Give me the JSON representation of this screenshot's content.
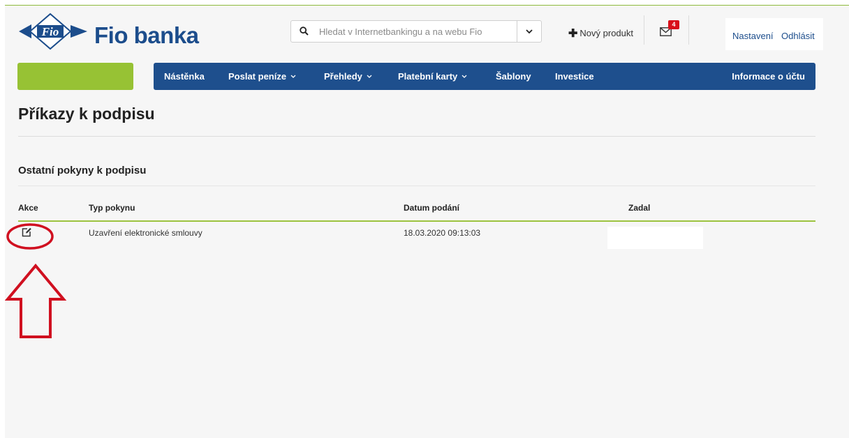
{
  "brand": {
    "name": "Fio banka",
    "logo_mark": "Fio"
  },
  "search": {
    "placeholder": "Hledat v Internetbankingu a na webu Fio"
  },
  "header": {
    "new_product_label": "Nový produkt",
    "messages_count": "4",
    "settings_label": "Nastavení",
    "logout_label": "Odhlásit"
  },
  "nav": {
    "items": [
      {
        "label": "Nástěnka"
      },
      {
        "label": "Poslat peníze"
      },
      {
        "label": "Přehledy"
      },
      {
        "label": "Platební karty"
      },
      {
        "label": "Šablony"
      },
      {
        "label": "Investice"
      },
      {
        "label": "Informace o účtu"
      }
    ]
  },
  "page": {
    "title": "Příkazy k podpisu",
    "section_title": "Ostatní pokyny k podpisu"
  },
  "table": {
    "columns": [
      "Akce",
      "Typ pokynu",
      "Datum podání",
      "Zadal"
    ],
    "rows": [
      {
        "type": "Uzavření elektronické smlouvy",
        "date": "18.03.2020 09:13:03",
        "submitted_by": ""
      }
    ]
  },
  "icons": {
    "search": "search-icon",
    "dropdown": "chevron-down-icon",
    "new_product": "plus-icon",
    "messages": "envelope-icon",
    "edit": "edit-icon"
  },
  "colors": {
    "brand_blue": "#1e4f8d",
    "accent_green": "#97c234",
    "badge_red": "#d8101a",
    "annotation_red": "#d01020"
  }
}
